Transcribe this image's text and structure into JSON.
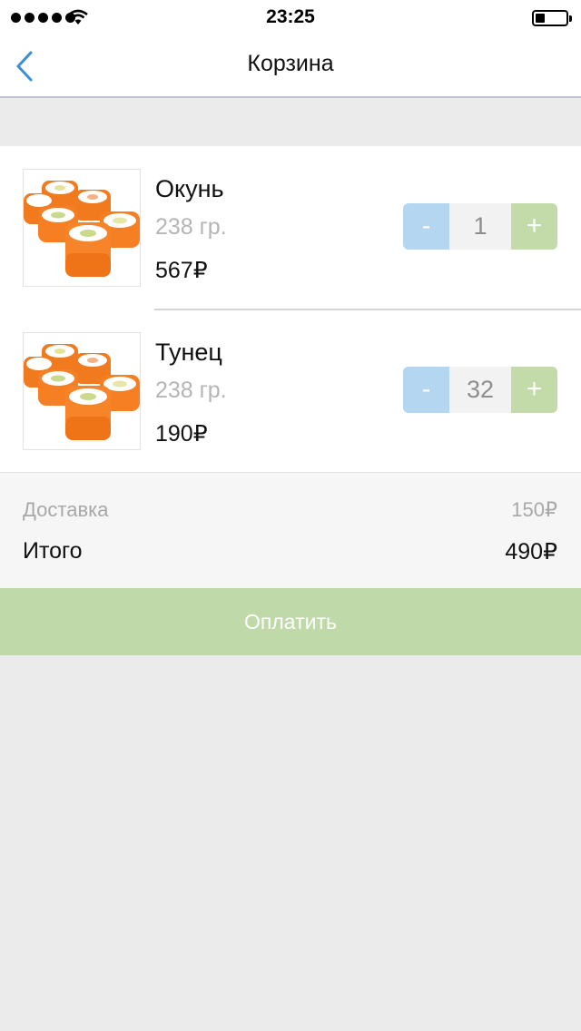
{
  "status_bar": {
    "time": "23:25",
    "signal_icon": "signal-dots-icon",
    "wifi_icon": "wifi-icon",
    "battery_icon": "battery-icon",
    "battery_level": 0.3
  },
  "nav": {
    "back_icon": "chevron-left-icon",
    "title": "Корзина"
  },
  "items": [
    {
      "name": "Окунь",
      "weight": "238 гр.",
      "price": "567₽",
      "quantity": "1",
      "minus_label": "-",
      "plus_label": "+",
      "image": "sushi-roll-image"
    },
    {
      "name": "Тунец",
      "weight": "238 гр.",
      "price": "190₽",
      "quantity": "32",
      "minus_label": "-",
      "plus_label": "+",
      "image": "sushi-roll-image"
    }
  ],
  "summary": {
    "delivery_label": "Доставка",
    "delivery_value": "150₽",
    "total_label": "Итого",
    "total_value": "490₽"
  },
  "pay_button_label": "Оплатить",
  "colors": {
    "accent_blue": "#3a8fd9",
    "minus_button": "#b5d6f0",
    "plus_button": "#c2dba9",
    "pay_button": "#c0d9a9",
    "background": "#ebebeb"
  }
}
